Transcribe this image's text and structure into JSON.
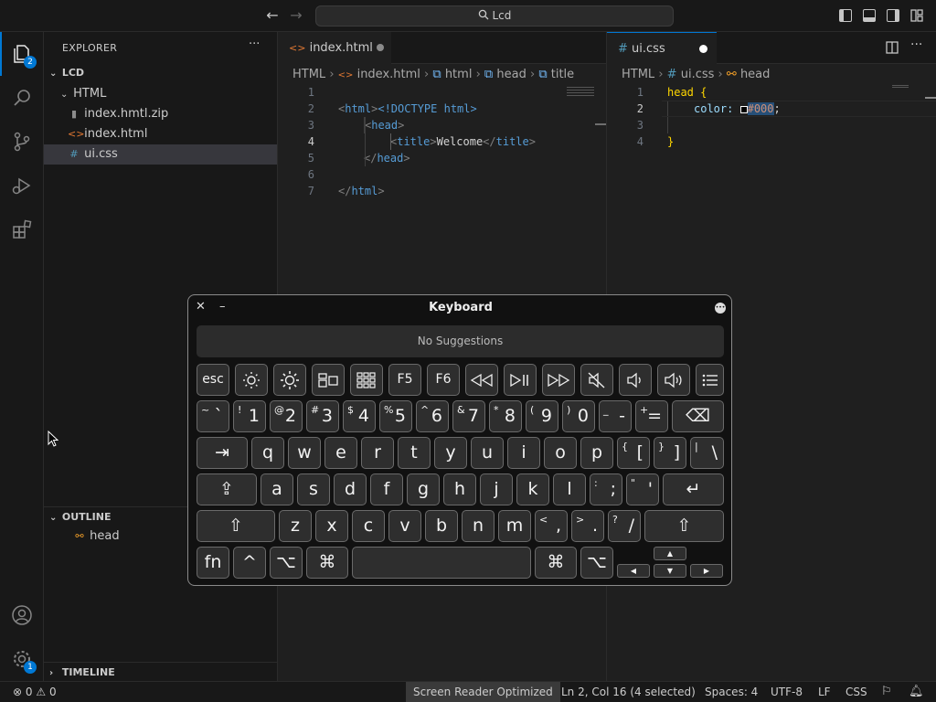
{
  "titlebar": {
    "search": "Lcd",
    "back": "←",
    "forward": "→"
  },
  "activity": {
    "explorer_badge": "2",
    "manage_badge": "1"
  },
  "sidebar": {
    "title": "EXPLORER",
    "menu": "···",
    "root": "LCD",
    "folder": "HTML",
    "files": [
      {
        "icon": "▮",
        "name": "index.hmtl.zip"
      },
      {
        "icon": "<>",
        "name": "index.html"
      },
      {
        "icon": "#",
        "name": "ui.css"
      }
    ],
    "outline_title": "OUTLINE",
    "outline_item": "head",
    "timeline_title": "TIMELINE"
  },
  "editor_left": {
    "tab": "index.html",
    "breadcrumb": {
      "a": "HTML",
      "b": "index.html",
      "c": "html",
      "d": "head",
      "e": "title"
    },
    "lines": [
      "1",
      "2",
      "3",
      "4",
      "5",
      "6",
      "7"
    ],
    "code": {
      "l1": "<!DOCTYPE html>",
      "l2a": "<",
      "l2b": "html",
      "l2c": ">",
      "l3a": "<",
      "l3b": "head",
      "l3c": ">",
      "l4a": "<",
      "l4b": "title",
      "l4c": ">",
      "l4d": "Welcome",
      "l4e": "</",
      "l4f": "title",
      "l4g": ">",
      "l5a": "</",
      "l5b": "head",
      "l5c": ">",
      "l7a": "</",
      "l7b": "html",
      "l7c": ">"
    }
  },
  "editor_right": {
    "tab": "ui.css",
    "breadcrumb": {
      "a": "HTML",
      "b": "ui.css",
      "c": "head"
    },
    "lines": [
      "1",
      "2",
      "3",
      "4"
    ],
    "code": {
      "sel": "head",
      "open": "{",
      "prop": "color:",
      "val": "#000",
      "semi": ";",
      "close": "}"
    }
  },
  "keyboard": {
    "title": "Keyboard",
    "suggestions": "No Suggestions",
    "row0": [
      "esc",
      "F5",
      "F6"
    ],
    "row1": [
      {
        "t": "~",
        "m": "`"
      },
      {
        "t": "!",
        "m": "1"
      },
      {
        "t": "@",
        "m": "2"
      },
      {
        "t": "#",
        "m": "3"
      },
      {
        "t": "$",
        "m": "4"
      },
      {
        "t": "%",
        "m": "5"
      },
      {
        "t": "^",
        "m": "6"
      },
      {
        "t": "&",
        "m": "7"
      },
      {
        "t": "*",
        "m": "8"
      },
      {
        "t": "(",
        "m": "9"
      },
      {
        "t": ")",
        "m": "0"
      },
      {
        "t": "_",
        "m": "-"
      },
      {
        "t": "+",
        "m": "="
      }
    ],
    "row2": [
      "q",
      "w",
      "e",
      "r",
      "t",
      "y",
      "u",
      "i",
      "o",
      "p"
    ],
    "row2b": [
      {
        "t": "{",
        "m": "["
      },
      {
        "t": "}",
        "m": "]"
      },
      {
        "t": "|",
        "m": "\\"
      }
    ],
    "row3": [
      "a",
      "s",
      "d",
      "f",
      "g",
      "h",
      "j",
      "k",
      "l"
    ],
    "row3b": [
      {
        "t": ":",
        "m": ";"
      },
      {
        "t": "\"",
        "m": "'"
      }
    ],
    "row4": [
      "z",
      "x",
      "c",
      "v",
      "b",
      "n",
      "m"
    ],
    "row4b": [
      {
        "t": "<",
        "m": ","
      },
      {
        "t": ">",
        "m": "."
      },
      {
        "t": "?",
        "m": "/"
      }
    ],
    "fn": "fn",
    "ctrl": "^",
    "opt": "⌥",
    "cmd": "⌘",
    "tab": "⇥",
    "shift": "⇧",
    "caps": "⇪",
    "ret": "↵",
    "del": "⌫",
    "arrows": {
      "up": "▲",
      "down": "▼",
      "left": "◀",
      "right": "▶"
    },
    "close": "✕",
    "min": "–",
    "more": "•••"
  },
  "status": {
    "errors": "0",
    "warnings": "0",
    "screen_reader": "Screen Reader Optimized",
    "position": "Ln 2, Col 16 (4 selected)",
    "spaces": "Spaces: 4",
    "encoding": "UTF-8",
    "eol": "LF",
    "language": "CSS"
  }
}
